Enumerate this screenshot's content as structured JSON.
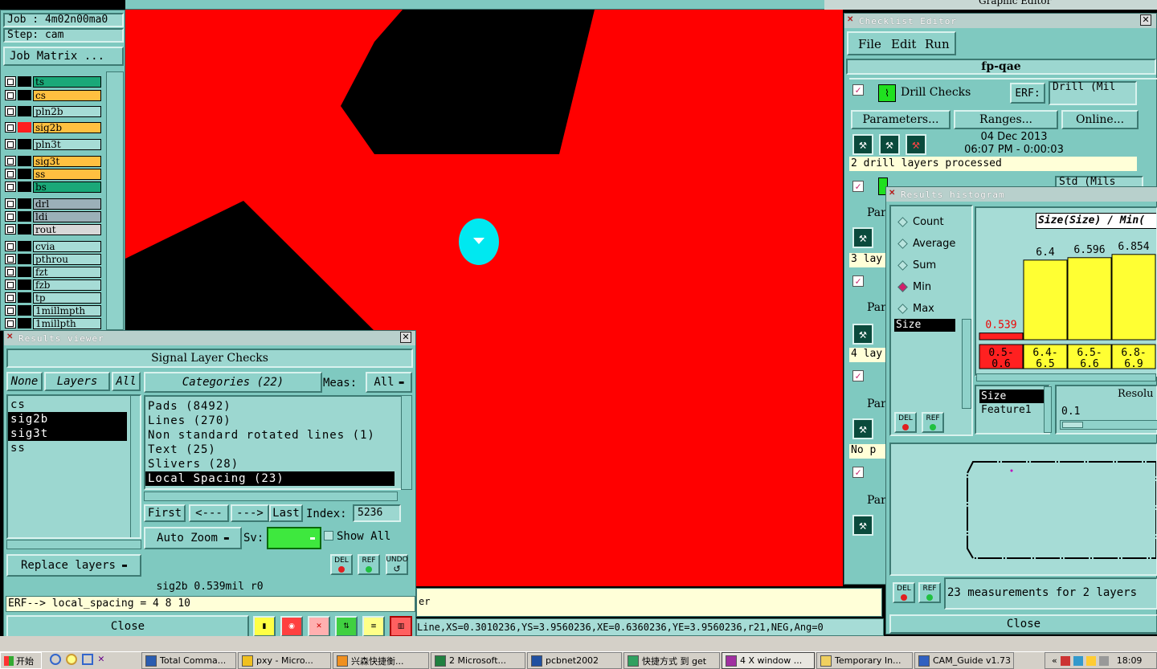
{
  "app": {
    "title_right": "Graphic Editor"
  },
  "job": {
    "job_label": "Job : 4m02n00ma0",
    "step_label": "Step: cam",
    "matrix_btn": "Job Matrix ..."
  },
  "layers": [
    {
      "name": "ts",
      "color": "#1aa878"
    },
    {
      "name": "cs",
      "color": "#ffc040"
    },
    {
      "name": "pln2b",
      "color": "#a6dcd6"
    },
    {
      "name": "sig2b",
      "color": "#ffc040"
    },
    {
      "name": "pln3t",
      "color": "#a6dcd6"
    },
    {
      "name": "sig3t",
      "color": "#ffc040"
    },
    {
      "name": "ss",
      "color": "#ffc040"
    },
    {
      "name": "bs",
      "color": "#1aa878"
    },
    {
      "name": "drl",
      "color": "#9bb0b8"
    },
    {
      "name": "ldi",
      "color": "#9bb0b8"
    },
    {
      "name": "rout",
      "color": "#d8d8d8"
    },
    {
      "name": "cvia",
      "color": "#a6dcd6"
    },
    {
      "name": "pthrou",
      "color": "#a6dcd6"
    },
    {
      "name": "fzt",
      "color": "#a6dcd6"
    },
    {
      "name": "fzb",
      "color": "#a6dcd6"
    },
    {
      "name": "tp",
      "color": "#a6dcd6"
    },
    {
      "name": "1millmpth",
      "color": "#a6dcd6"
    },
    {
      "name": "1millpth",
      "color": "#a6dcd6"
    }
  ],
  "results_viewer": {
    "title": "Results viewer",
    "header": "Signal Layer Checks",
    "none_btn": "None",
    "layers_btn": "Layers",
    "all_btn": "All",
    "layer_list": [
      "cs",
      "sig2b",
      "sig3t",
      "ss"
    ],
    "categories_btn": "Categories (22)",
    "meas_label": "Meas:",
    "meas_value": "All",
    "categories": [
      "Pads (8492)",
      "Lines (270)",
      "Non standard rotated lines (1)",
      "Text (25)",
      "Slivers (28)",
      "Local Spacing (23)"
    ],
    "first": "First",
    "prev": "<---",
    "next": "--->",
    "last": "Last",
    "index_label": "Index:",
    "index_value": "5236",
    "auto_zoom": "Auto Zoom",
    "sv_label": "Sv:",
    "show_all": "Show All",
    "del": "DEL",
    "ref": "REF",
    "undo": "UNDO",
    "replace_layers": "Replace layers",
    "status": "sig2b 0.539mil  r0",
    "erf": "ERF--> local_spacing = 4 8 10",
    "close": "Close"
  },
  "checklist": {
    "title": "Checklist Editor",
    "menu": [
      "File",
      "Edit",
      "Run"
    ],
    "name": "fp-qae",
    "check_name": "Drill Checks",
    "erf_label": "ERF:",
    "erf_value": "Drill (Mil",
    "params": "Parameters...",
    "ranges": "Ranges...",
    "online": "Online...",
    "date": "04 Dec 2013",
    "time": "06:07 PM - 0:00:03",
    "processed": "2 drill layers processed",
    "erf2_value": "Std (Mils",
    "par": "Par",
    "lay3": "3 lay",
    "lay4": "4 lay",
    "nop": "No p"
  },
  "histogram": {
    "title": "Results histogram",
    "modes": [
      "Count",
      "Average",
      "Sum",
      "Min",
      "Max"
    ],
    "selected_mode": "Min",
    "list1": [
      "Size"
    ],
    "list2": [
      "Size",
      "Feature1"
    ],
    "heading": "Size(Size) / Min(",
    "resolution_label": "Resolu",
    "resolution_value": "0.1",
    "del": "DEL",
    "ref": "REF",
    "summary": "23 measurements for 2 layers",
    "close": "Close"
  },
  "chart_data": {
    "type": "bar",
    "categories": [
      "0.5-0.6",
      "6.4-6.5",
      "6.5-6.6",
      "6.8-6.9"
    ],
    "values": [
      0.539,
      6.4,
      6.596,
      6.854
    ],
    "value_labels": [
      "0.539",
      "6.4",
      "6.596",
      "6.854"
    ],
    "colors": [
      "#ff2020",
      "#ffff33",
      "#ffff33",
      "#ffff33"
    ]
  },
  "status_bar": {
    "message": "er",
    "coords": "Line,XS=0.3010236,YS=3.9560236,XE=0.6360236,YE=3.9560236,r21,NEG,Ang=0"
  },
  "taskbar": {
    "start": "开始",
    "tasks": [
      "Total Comma...",
      "pxy - Micro...",
      "兴森快捷衡...",
      "2 Microsoft...",
      "pcbnet2002",
      "快捷方式 到 get",
      "4 X window ...",
      "Temporary In...",
      "CAM_Guide v1.73"
    ],
    "clock": "18:09"
  }
}
